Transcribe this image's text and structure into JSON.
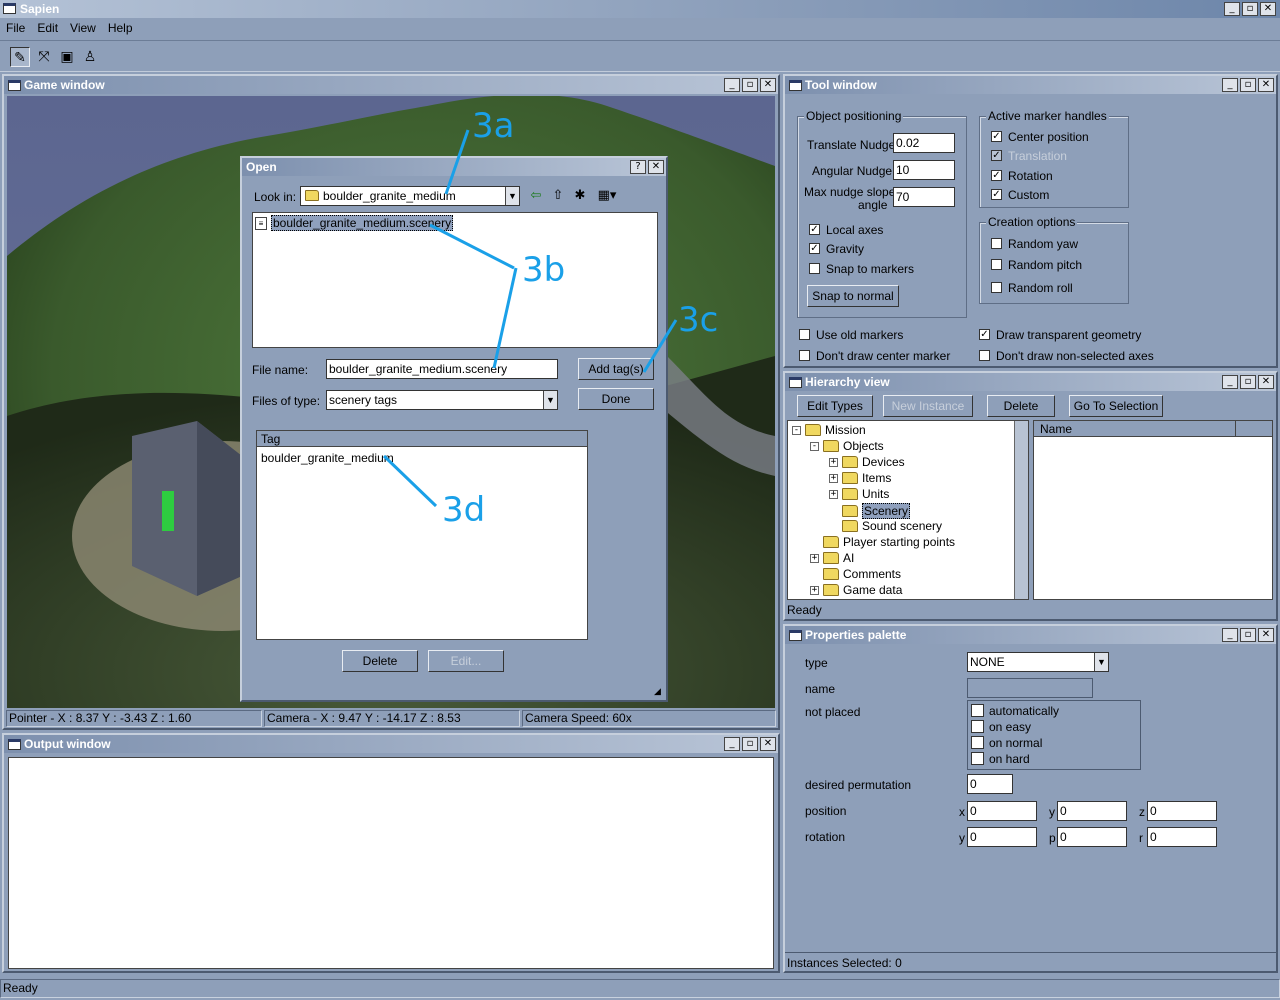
{
  "app": {
    "title": "Sapien"
  },
  "menu": [
    "File",
    "Edit",
    "View",
    "Help"
  ],
  "toolbar": {
    "icons": [
      "pencil-icon",
      "pointer-tool-icon",
      "camera-icon",
      "actor-icon"
    ]
  },
  "window_controls": {
    "minimize": "_",
    "restore": "▫",
    "close": "✕"
  },
  "game_window": {
    "title": "Game window",
    "status": {
      "pointer": "Pointer - X : 8.37  Y : -3.43  Z : 1.60",
      "camera": "Camera - X : 9.47  Y : -14.17  Z : 8.53",
      "speed": "Camera Speed: 60x"
    }
  },
  "open_dialog": {
    "title": "Open",
    "help": "?",
    "close": "✕",
    "look_in_label": "Look in:",
    "look_in_value": "boulder_granite_medium",
    "file_item": "boulder_granite_medium.scenery",
    "file_name_label": "File name:",
    "file_name_value": "boulder_granite_medium.scenery",
    "files_of_type_label": "Files of type:",
    "files_of_type_value": "scenery tags",
    "add_tags": "Add tag(s)",
    "done": "Done",
    "tag_header": "Tag",
    "tag_item": "boulder_granite_medium",
    "delete": "Delete",
    "edit": "Edit..."
  },
  "callouts": {
    "a": "3a",
    "b": "3b",
    "c": "3c",
    "d": "3d"
  },
  "output_window": {
    "title": "Output window"
  },
  "tool_window": {
    "title": "Tool window",
    "object_positioning": {
      "label": "Object positioning",
      "translate_nudge": {
        "label": "Translate Nudge",
        "value": "0.02"
      },
      "angular_nudge": {
        "label": "Angular Nudge",
        "value": "10"
      },
      "max_nudge_line1": "Max nudge slope",
      "max_nudge_line2": "angle",
      "max_nudge_value": "70",
      "local_axes": "Local axes",
      "gravity": "Gravity",
      "snap_to_markers": "Snap to markers",
      "snap_to_normal": "Snap to normal"
    },
    "active_marker_handles": {
      "label": "Active marker handles",
      "center_position": "Center position",
      "translation": "Translation",
      "rotation": "Rotation",
      "custom": "Custom"
    },
    "creation_options": {
      "label": "Creation options",
      "random_yaw": "Random yaw",
      "random_pitch": "Random pitch",
      "random_roll": "Random roll"
    },
    "use_old_markers": "Use old markers",
    "dont_draw_center": "Don't draw center marker",
    "draw_transparent": "Draw transparent geometry",
    "dont_draw_nonselected": "Don't draw non-selected axes"
  },
  "hierarchy": {
    "title": "Hierarchy view",
    "buttons": {
      "edit_types": "Edit Types",
      "new_instance": "New Instance",
      "delete": "Delete",
      "go_to_selection": "Go To Selection"
    },
    "tree": [
      "Mission",
      "Objects",
      "Devices",
      "Items",
      "Units",
      "Scenery",
      "Sound scenery",
      "Player starting points",
      "AI",
      "Comments",
      "Game data"
    ],
    "name_header": "Name",
    "status": "Ready"
  },
  "properties": {
    "title": "Properties palette",
    "type_label": "type",
    "type_value": "NONE",
    "name_label": "name",
    "not_placed_label": "not placed",
    "not_placed_options": [
      "automatically",
      "on easy",
      "on normal",
      "on hard"
    ],
    "desired_permutation_label": "desired permutation",
    "desired_permutation_value": "0",
    "position_label": "position",
    "rotation_label": "rotation",
    "pos_axes": [
      "x",
      "y",
      "z"
    ],
    "rot_axes": [
      "y",
      "p",
      "r"
    ],
    "zero": "0",
    "status": "Instances Selected: 0"
  },
  "status_bar": {
    "text": "Ready"
  }
}
